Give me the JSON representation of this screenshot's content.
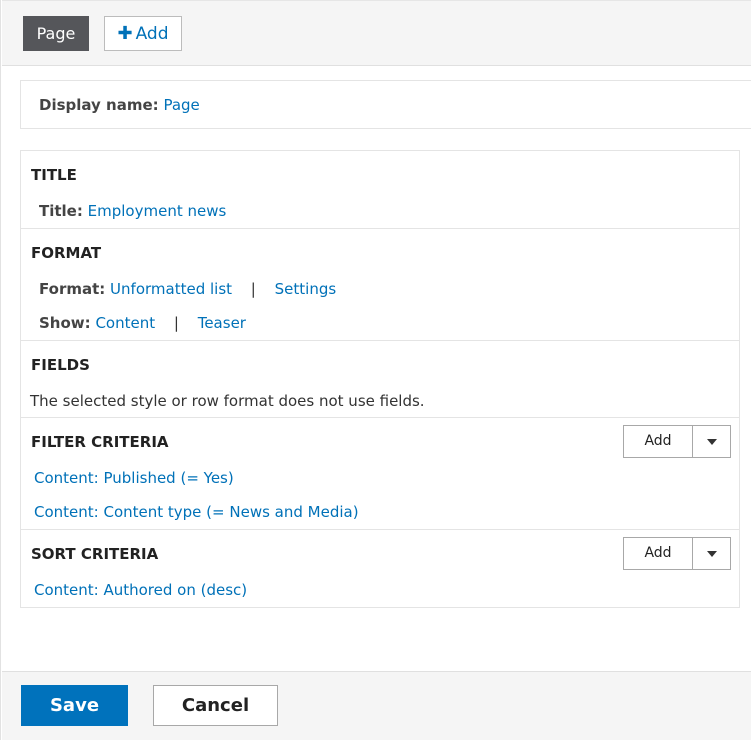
{
  "display_tabs": {
    "current": "Page",
    "add_label": "Add"
  },
  "display_name": {
    "label": "Display name:",
    "value": "Page"
  },
  "title_section": {
    "heading": "TITLE",
    "label": "Title:",
    "value": "Employment news"
  },
  "format_section": {
    "heading": "FORMAT",
    "format_label": "Format:",
    "format_value": "Unformatted list",
    "separator": "|",
    "settings_link": "Settings",
    "show_label": "Show:",
    "show_value": "Content",
    "teaser_link": "Teaser"
  },
  "fields_section": {
    "heading": "FIELDS",
    "note": "The selected style or row format does not use fields."
  },
  "filter_section": {
    "heading": "FILTER CRITERIA",
    "add_label": "Add",
    "items": [
      "Content: Published (= Yes)",
      "Content: Content type (= News and Media)"
    ]
  },
  "sort_section": {
    "heading": "SORT CRITERIA",
    "add_label": "Add",
    "items": [
      "Content: Authored on (desc)"
    ]
  },
  "footer": {
    "save_label": "Save",
    "cancel_label": "Cancel"
  },
  "colors": {
    "link": "#0071b8",
    "primary_button": "#0072bc",
    "active_tab": "#55565a"
  }
}
